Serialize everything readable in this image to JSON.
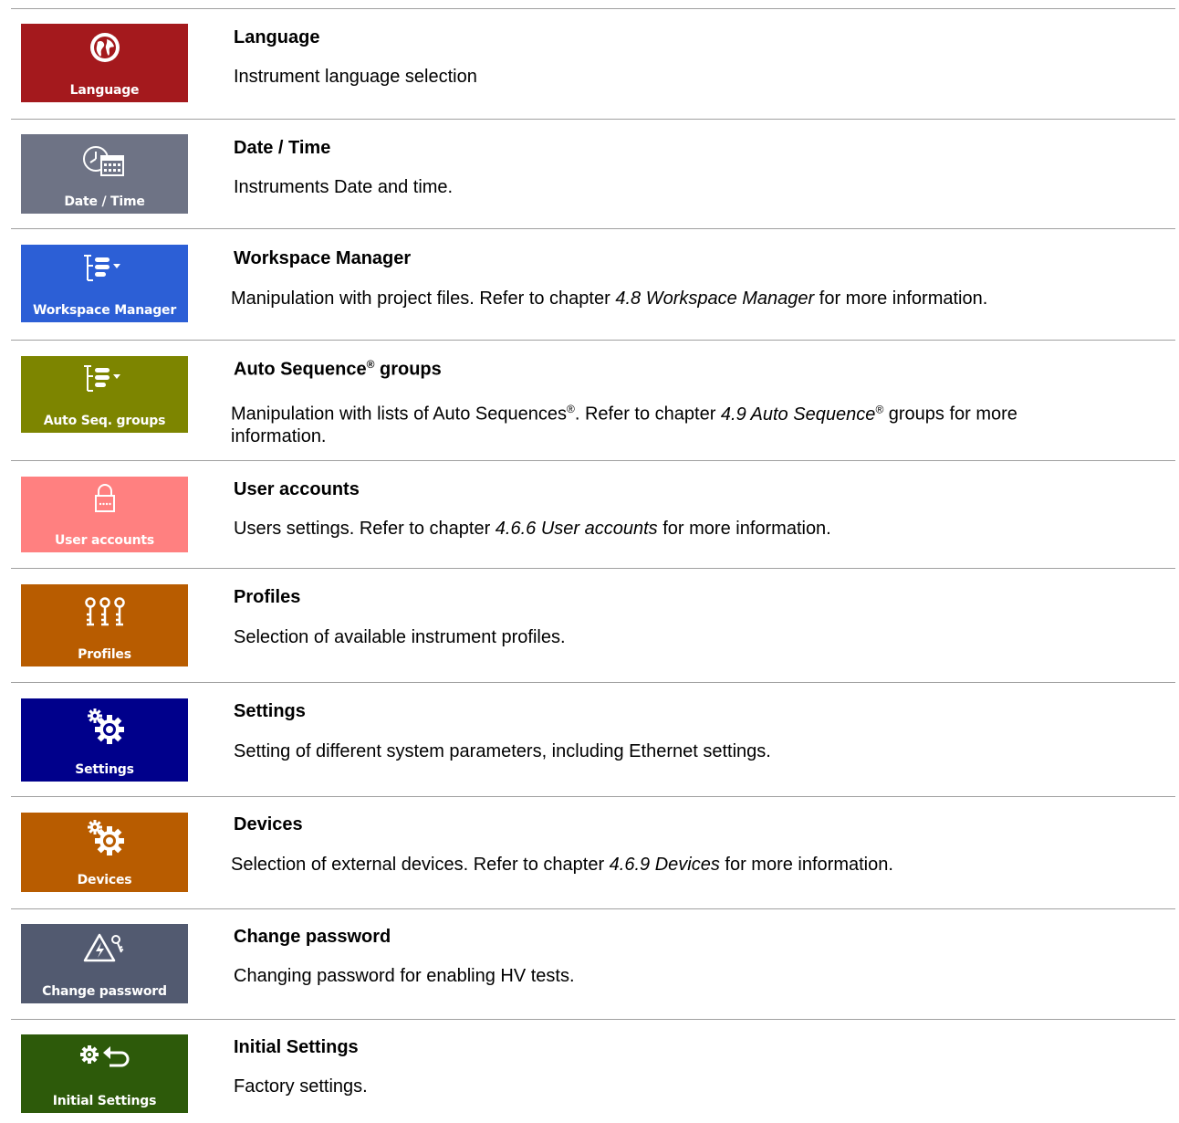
{
  "colors": {
    "language": "#a4191d",
    "datetime": "#6e7385",
    "workspace": "#2c5fd6",
    "autoseq": "#7d8500",
    "users": "#ff8080",
    "profiles": "#b85c00",
    "settings": "#00008b",
    "devices": "#b85c00",
    "password": "#525a70",
    "initial": "#2d5a0a",
    "divider": "#a0a0a0"
  },
  "items": [
    {
      "tile_label": "Language",
      "icon": "globe-icon",
      "title": "Language",
      "desc": {
        "text": "Instrument language selection"
      }
    },
    {
      "tile_label": "Date / Time",
      "icon": "clock-calendar-icon",
      "title": "Date / Time",
      "desc": {
        "text": "Instruments Date and time."
      }
    },
    {
      "tile_label": "Workspace Manager",
      "icon": "tree-list-icon",
      "title": "Workspace Manager",
      "desc": {
        "pre": "Manipulation with project files. Refer to chapter ",
        "ref": "4.8 Workspace Manager",
        "post": " for more information."
      }
    },
    {
      "tile_label": "Auto Seq. groups",
      "icon": "tree-list-icon",
      "title_main": "Auto Sequence",
      "title_reg": "®",
      "title_tail": " groups",
      "desc": {
        "pre": "Manipulation with lists of Auto Sequences",
        "reg": "®",
        "mid": ". Refer to chapter ",
        "ref": "4.9 Auto Sequence",
        "ref_reg": "®",
        "post": " groups for more",
        "line2": "information."
      }
    },
    {
      "tile_label": "User accounts",
      "icon": "lock-icon",
      "title": "User accounts",
      "desc": {
        "pre": "Users settings. Refer to chapter ",
        "ref": "4.6.6 User accounts",
        "post": " for more information."
      }
    },
    {
      "tile_label": "Profiles",
      "icon": "keys-icon",
      "title": "Profiles",
      "desc": {
        "text": "Selection of available instrument profiles."
      }
    },
    {
      "tile_label": "Settings",
      "icon": "gears-icon",
      "title": "Settings",
      "desc": {
        "text": "Setting of different system parameters, including Ethernet settings."
      }
    },
    {
      "tile_label": "Devices",
      "icon": "gears-icon",
      "title": "Devices",
      "desc": {
        "pre": "Selection of external devices. Refer to chapter ",
        "ref": "4.6.9 Devices",
        "post": " for more information."
      }
    },
    {
      "tile_label": "Change password",
      "icon": "hv-warning-key-icon",
      "title": "Change password",
      "desc": {
        "text": "Changing password for enabling HV tests."
      }
    },
    {
      "tile_label": "Initial Settings",
      "icon": "gear-return-icon",
      "title": "Initial Settings",
      "desc": {
        "text": "Factory settings."
      }
    }
  ]
}
